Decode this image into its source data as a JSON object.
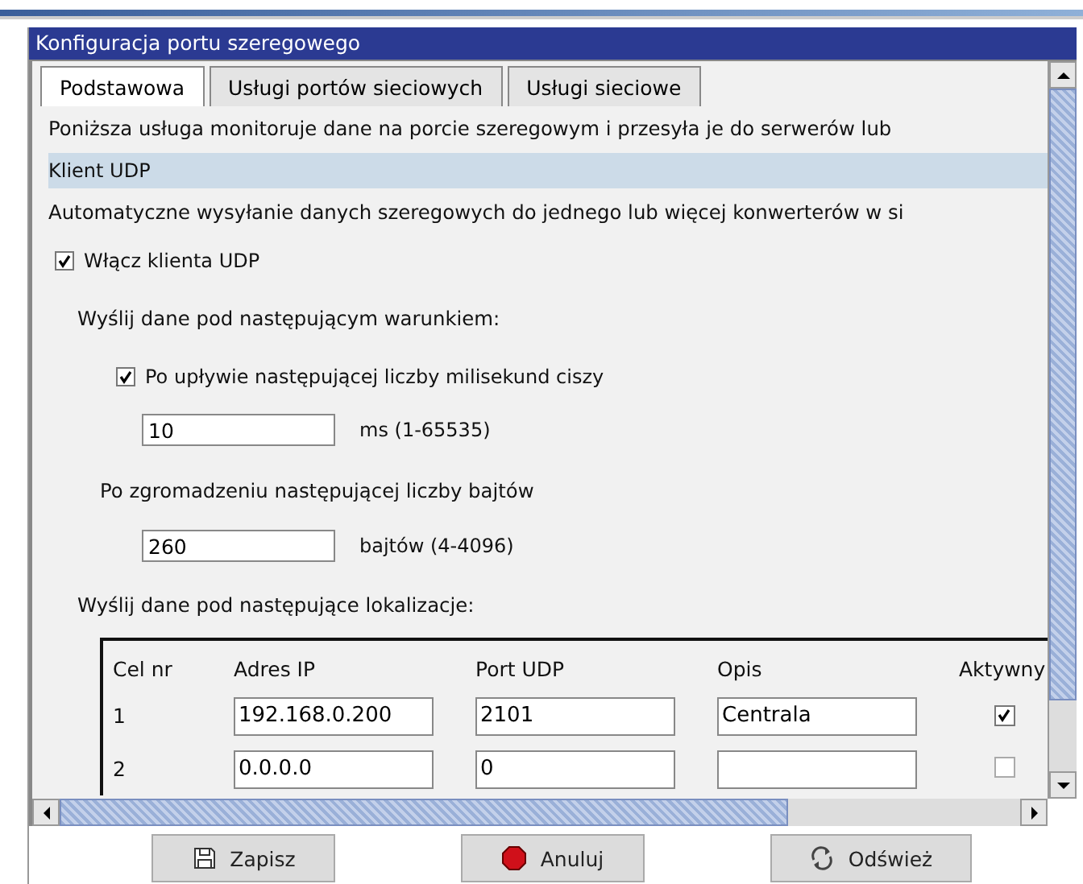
{
  "window": {
    "title": "Konfiguracja portu szeregowego"
  },
  "tabs": [
    {
      "label": "Podstawowa",
      "selected": true
    },
    {
      "label": "Usługi portów sieciowych",
      "selected": false
    },
    {
      "label": "Usługi sieciowe",
      "selected": false
    }
  ],
  "intro": "Poniższa usługa monitoruje dane na porcie szeregowym i przesyła je do serwerów lub",
  "section": {
    "title": "Klient UDP",
    "description": "Automatyczne wysyłanie danych szeregowych do jednego lub więcej konwerterów w si"
  },
  "enable": {
    "label": "Włącz klienta UDP",
    "checked": true
  },
  "condition_label": "Wyślij dane pod następującym warunkiem:",
  "silence": {
    "label": "Po upływie następującej liczby milisekund ciszy",
    "checked": true,
    "value": "10",
    "unit": "ms (1-65535)"
  },
  "bytes": {
    "label": "Po zgromadzeniu następującej liczby bajtów",
    "value": "260",
    "unit": "bajtów (4-4096)"
  },
  "destinations_label": "Wyślij dane pod następujące lokalizacje:",
  "table": {
    "columns": [
      "Cel nr",
      "Adres IP",
      "Port UDP",
      "Opis",
      "Aktywny"
    ],
    "rows": [
      {
        "number": "1",
        "ip": "192.168.0.200",
        "port": "2101",
        "description": "Centrala",
        "active": true
      },
      {
        "number": "2",
        "ip": "0.0.0.0",
        "port": "0",
        "active": false
      }
    ]
  },
  "buttons": [
    {
      "kind": "save",
      "label": "Zapisz"
    },
    {
      "kind": "cancel",
      "label": "Anuluj"
    },
    {
      "kind": "refresh",
      "label": "Odśwież"
    }
  ]
}
